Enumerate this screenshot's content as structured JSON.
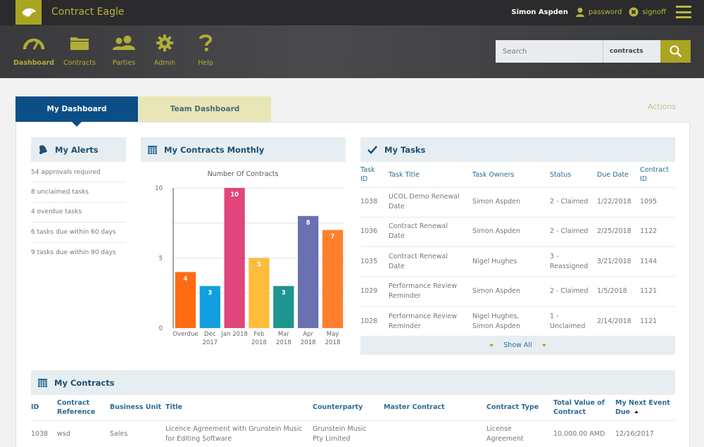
{
  "app": {
    "title": "Contract Eagle",
    "user_name": "Simon Aspden",
    "password_link": "password",
    "signoff_link": "signoff"
  },
  "nav": {
    "items": [
      {
        "label": "Dashboard",
        "icon": "gauge-icon",
        "active": true
      },
      {
        "label": "Contracts",
        "icon": "folder-icon"
      },
      {
        "label": "Parties",
        "icon": "users-icon"
      },
      {
        "label": "Admin",
        "icon": "gear-icon"
      },
      {
        "label": "Help",
        "icon": "question-icon"
      }
    ]
  },
  "search": {
    "placeholder": "Search",
    "scope": "contracts"
  },
  "tabs": {
    "my_dashboard": "My Dashboard",
    "team_dashboard": "Team Dashboard",
    "actions": "Actions"
  },
  "alerts": {
    "title": "My Alerts",
    "items": [
      "54 approvals required",
      "8 unclaimed tasks",
      "4 overdue tasks",
      "6 tasks due within 60 days",
      "9 tasks due within 90 days"
    ]
  },
  "contracts_monthly": {
    "title": "My Contracts Monthly"
  },
  "chart_data": {
    "type": "bar",
    "title": "Number Of Contracts",
    "categories": [
      [
        "Overdue"
      ],
      [
        "Dec",
        "2017"
      ],
      [
        "Jan 2018"
      ],
      [
        "Feb",
        "2018"
      ],
      [
        "Mar",
        "2018"
      ],
      [
        "Apr",
        "2018"
      ],
      [
        "May",
        "2018"
      ]
    ],
    "values": [
      4,
      3,
      10,
      5,
      3,
      8,
      7
    ],
    "colors": [
      "#ff6a13",
      "#119fdf",
      "#e1467c",
      "#ffbc3b",
      "#1e958f",
      "#6b71b0",
      "#ff7f2e"
    ],
    "yticks": [
      0,
      5,
      10
    ],
    "ylim": [
      0,
      10
    ],
    "grid": true,
    "xlabel": "",
    "ylabel": "",
    "data_labels": true
  },
  "tasks": {
    "title": "My Tasks",
    "columns": [
      [
        "Task",
        "ID"
      ],
      [
        "Task Title"
      ],
      [
        "Task Owners"
      ],
      [
        "Status"
      ],
      [
        "Due Date"
      ],
      [
        "Contract",
        "ID"
      ]
    ],
    "rows": [
      {
        "id": "1038",
        "title": [
          "UCOL Demo Renewal",
          "Date"
        ],
        "owners": [
          "Simon Aspden"
        ],
        "status": [
          "2 - Claimed"
        ],
        "due": "1/22/2018",
        "contract_id": "1095"
      },
      {
        "id": "1036",
        "title": [
          "Contract Renewal",
          "Date"
        ],
        "owners": [
          "Simon Aspden"
        ],
        "status": [
          "2 - Claimed"
        ],
        "due": "2/25/2018",
        "contract_id": "1122"
      },
      {
        "id": "1035",
        "title": [
          "Contract Renewal",
          "Date"
        ],
        "owners": [
          "Nigel Hughes"
        ],
        "status": [
          "3 -",
          "Reassigned"
        ],
        "due": "3/21/2018",
        "contract_id": "1144"
      },
      {
        "id": "1029",
        "title": [
          "Performance Review",
          "Reminder"
        ],
        "owners": [
          "Simon Aspden"
        ],
        "status": [
          "2 - Claimed"
        ],
        "due": "1/5/2018",
        "contract_id": "1121"
      },
      {
        "id": "1028",
        "title": [
          "Performance Review",
          "Reminder"
        ],
        "owners": [
          "Nigel Hughes,",
          "Simon Aspden"
        ],
        "status": [
          "1 -",
          "Unclaimed"
        ],
        "due": "2/14/2018",
        "contract_id": "1121"
      }
    ],
    "show_all": "Show All"
  },
  "contracts": {
    "title": "My Contracts",
    "columns": [
      [
        "ID"
      ],
      [
        "Contract",
        "Reference"
      ],
      [
        "Business Unit"
      ],
      [
        "Title"
      ],
      [
        "Counterparty"
      ],
      [
        "Master Contract"
      ],
      [
        "Contract Type"
      ],
      [
        "Total Value of",
        "Contract"
      ],
      [
        "My Next Event",
        "Due"
      ]
    ],
    "rows": [
      {
        "id": "1038",
        "reference": "wsd",
        "business_unit": "Sales",
        "title": [
          "Licence Agreement with Grunstein Music",
          "for Editing Software"
        ],
        "counterparty": [
          "Grunstein Music",
          "Pty Limited"
        ],
        "master_contract": "",
        "type": [
          "License",
          "Agreement"
        ],
        "value": "10,000.00 AMD",
        "next_event": "12/16/2017"
      }
    ]
  }
}
